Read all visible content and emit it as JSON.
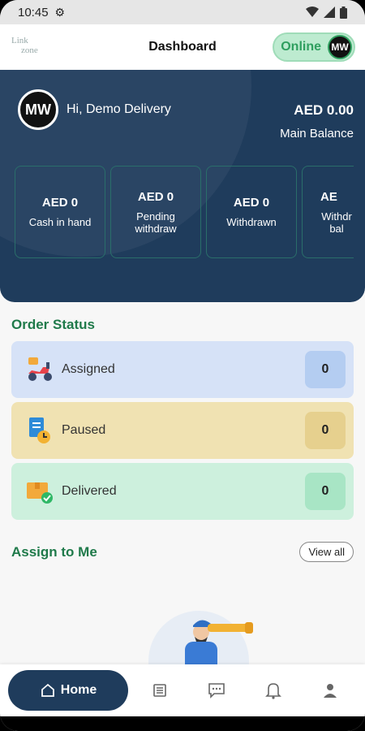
{
  "status_bar": {
    "time": "10:45"
  },
  "app_bar": {
    "logo_line1": "Link",
    "logo_line2": "zone",
    "title": "Dashboard",
    "online_label": "Online",
    "avatar_text": "MW"
  },
  "hero": {
    "greeting": "Hi, Demo Delivery",
    "avatar_text": "MW",
    "main_balance_amount": "AED 0.00",
    "main_balance_label": "Main Balance",
    "stats": [
      {
        "value": "AED 0",
        "label": "Cash in hand"
      },
      {
        "value": "AED 0",
        "label": "Pending withdraw"
      },
      {
        "value": "AED 0",
        "label": "Withdrawn"
      },
      {
        "value": "AE",
        "label": "Withdr bal"
      }
    ]
  },
  "order_status": {
    "title": "Order Status",
    "items": [
      {
        "label": "Assigned",
        "count": "0",
        "icon": "scooter-icon"
      },
      {
        "label": "Paused",
        "count": "0",
        "icon": "clock-document-icon"
      },
      {
        "label": "Delivered",
        "count": "0",
        "icon": "box-check-icon"
      }
    ]
  },
  "assign": {
    "title": "Assign to Me",
    "view_all": "View all"
  },
  "bottom_nav": {
    "home_label": "Home",
    "icons": [
      "home-icon",
      "list-icon",
      "chat-icon",
      "bell-icon",
      "profile-icon"
    ]
  },
  "colors": {
    "primary": "#1f3c5c",
    "accent_green": "#1f7a4a",
    "online_bg": "#bdebd0"
  }
}
